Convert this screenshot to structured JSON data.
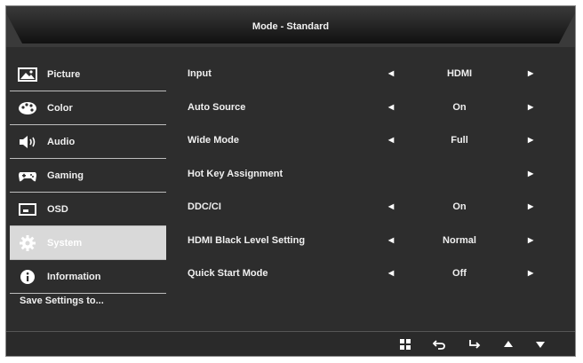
{
  "title": "Mode - Standard",
  "sidebar": {
    "items": [
      {
        "label": "Picture",
        "icon": "picture-icon",
        "active": false
      },
      {
        "label": "Color",
        "icon": "color-palette-icon",
        "active": false
      },
      {
        "label": "Audio",
        "icon": "speaker-icon",
        "active": false
      },
      {
        "label": "Gaming",
        "icon": "gamepad-icon",
        "active": false
      },
      {
        "label": "OSD",
        "icon": "osd-screen-icon",
        "active": false
      },
      {
        "label": "System",
        "icon": "gear-icon",
        "active": true
      },
      {
        "label": "Information",
        "icon": "info-icon",
        "active": false
      }
    ],
    "save_settings": "Save Settings to..."
  },
  "settings": [
    {
      "label": "Input",
      "value": "HDMI",
      "left_arrow": true,
      "right_arrow": true
    },
    {
      "label": "Auto Source",
      "value": "On",
      "left_arrow": true,
      "right_arrow": true
    },
    {
      "label": "Wide Mode",
      "value": "Full",
      "left_arrow": true,
      "right_arrow": true
    },
    {
      "label": "Hot Key Assignment",
      "value": "",
      "left_arrow": false,
      "right_arrow": true
    },
    {
      "label": "DDC/CI",
      "value": "On",
      "left_arrow": true,
      "right_arrow": true
    },
    {
      "label": "HDMI Black Level Setting",
      "value": "Normal",
      "left_arrow": true,
      "right_arrow": true
    },
    {
      "label": "Quick Start Mode",
      "value": "Off",
      "left_arrow": true,
      "right_arrow": true
    }
  ],
  "footer": {
    "buttons": [
      "menu-grid-icon",
      "back-icon",
      "enter-icon",
      "up-arrow-icon",
      "down-arrow-icon"
    ]
  },
  "colors": {
    "background": "#2d2d2d",
    "active_item": "#d9d9d9",
    "text": "#f0f0f0"
  }
}
